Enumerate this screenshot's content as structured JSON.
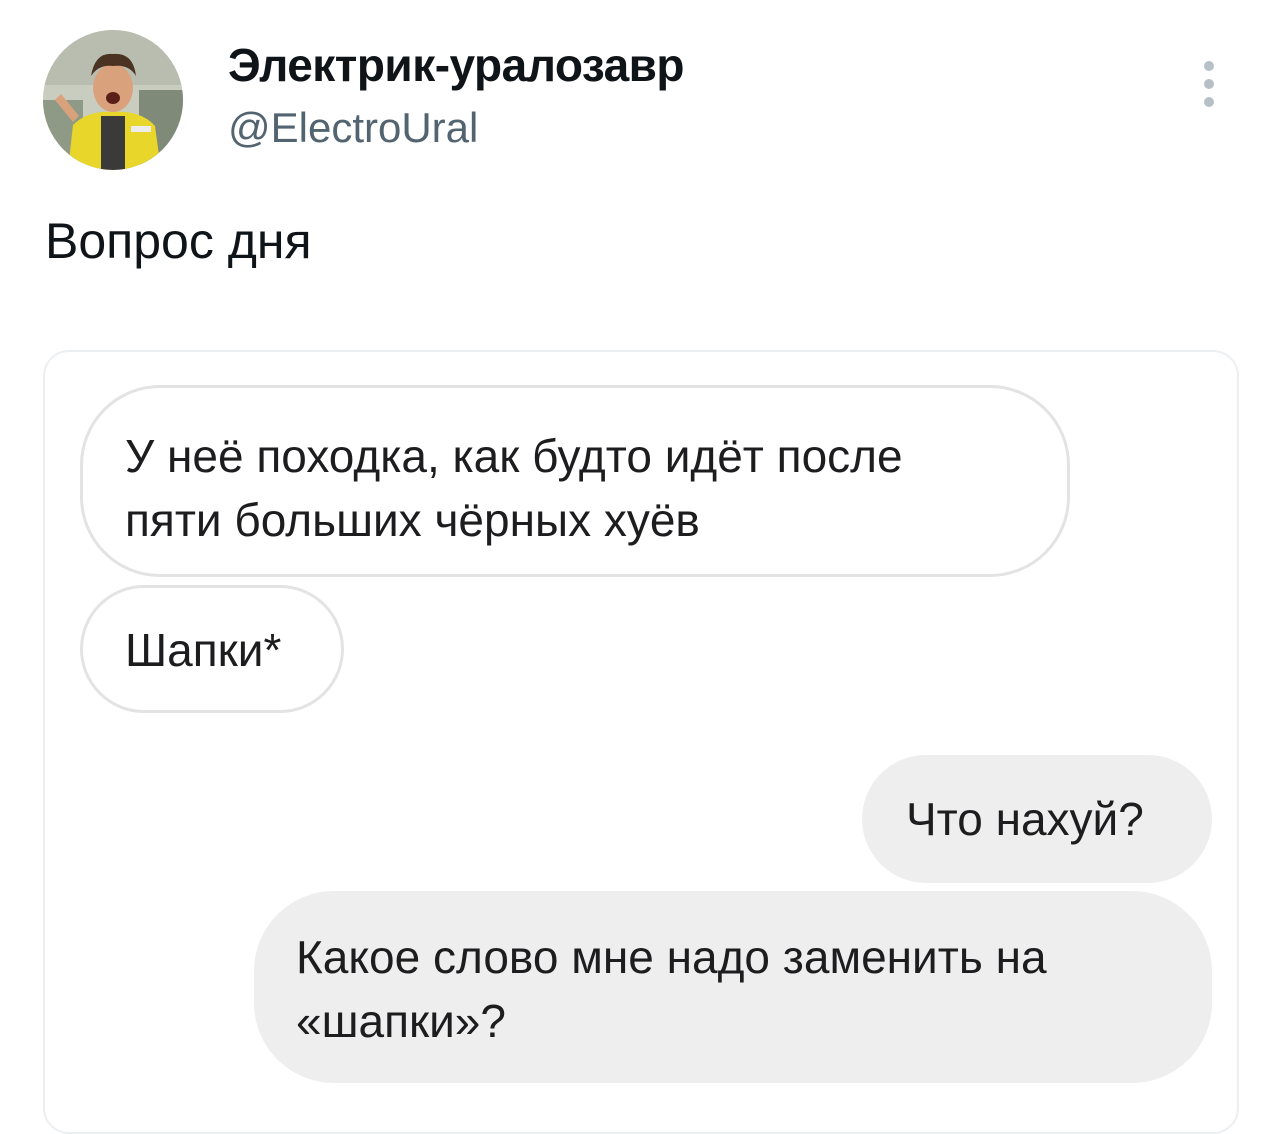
{
  "author": {
    "display_name": "Электрик-уралозавр",
    "handle": "@ElectroUral",
    "avatar_icon": "user-avatar-photo"
  },
  "menu": {
    "icon": "more-vertical-icon"
  },
  "tweet": {
    "text": "Вопрос дня"
  },
  "chat": {
    "messages": [
      {
        "side": "incoming",
        "lines": [
          "У неё походка, как будто идёт после",
          "пяти больших чёрных хуёв"
        ]
      },
      {
        "side": "incoming",
        "lines": [
          "Шапки*"
        ]
      },
      {
        "side": "outgoing",
        "lines": [
          "Что нахуй?"
        ]
      },
      {
        "side": "outgoing",
        "lines": [
          "Какое слово мне надо заменить на",
          "«шапки»?"
        ]
      }
    ],
    "colors": {
      "incoming_bg": "#ffffff",
      "incoming_border": "#e3e3e3",
      "outgoing_bg": "#eeeeee"
    }
  },
  "colors": {
    "primary_text": "#0f1419",
    "secondary_text": "#536471"
  }
}
